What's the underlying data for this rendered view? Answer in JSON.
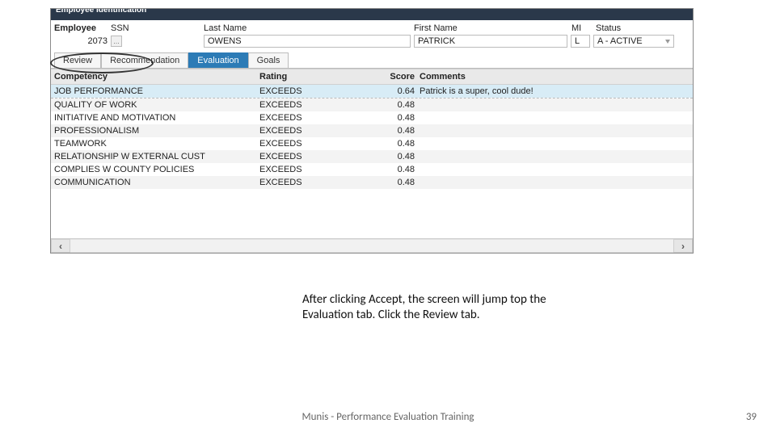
{
  "section_title": "Employee Identification",
  "field_labels": {
    "employee": "Employee",
    "ssn": "SSN",
    "last_name": "Last Name",
    "first_name": "First Name",
    "mi": "MI",
    "status": "Status"
  },
  "employee": {
    "number": "2073",
    "ssn": "",
    "last_name": "OWENS",
    "first_name": "PATRICK",
    "mi": "L",
    "status": "A - ACTIVE"
  },
  "tabs": [
    {
      "label": "Review",
      "active": false
    },
    {
      "label": "Recommendation",
      "active": false
    },
    {
      "label": "Evaluation",
      "active": true
    },
    {
      "label": "Goals",
      "active": false
    }
  ],
  "grid": {
    "headers": {
      "competency": "Competency",
      "rating": "Rating",
      "score": "Score",
      "comments": "Comments"
    },
    "rows": [
      {
        "competency": "JOB PERFORMANCE",
        "rating": "EXCEEDS",
        "score": "0.64",
        "comments": "Patrick is a super, cool dude!",
        "highlight": true
      },
      {
        "competency": "QUALITY OF WORK",
        "rating": "EXCEEDS",
        "score": "0.48",
        "comments": ""
      },
      {
        "competency": "INITIATIVE AND MOTIVATION",
        "rating": "EXCEEDS",
        "score": "0.48",
        "comments": ""
      },
      {
        "competency": "PROFESSIONALISM",
        "rating": "EXCEEDS",
        "score": "0.48",
        "comments": ""
      },
      {
        "competency": "TEAMWORK",
        "rating": "EXCEEDS",
        "score": "0.48",
        "comments": ""
      },
      {
        "competency": "RELATIONSHIP W EXTERNAL CUST",
        "rating": "EXCEEDS",
        "score": "0.48",
        "comments": ""
      },
      {
        "competency": "COMPLIES W COUNTY POLICIES",
        "rating": "EXCEEDS",
        "score": "0.48",
        "comments": ""
      },
      {
        "competency": "COMMUNICATION",
        "rating": "EXCEEDS",
        "score": "0.48",
        "comments": ""
      }
    ]
  },
  "caption": "After clicking Accept, the screen will jump top the Evaluation tab.  Click the Review tab.",
  "footer": "Munis - Performance Evaluation Training",
  "page_number": "39"
}
